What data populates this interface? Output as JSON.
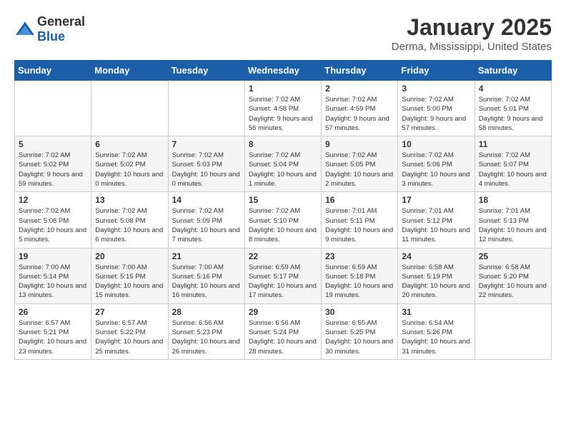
{
  "header": {
    "logo_general": "General",
    "logo_blue": "Blue",
    "title": "January 2025",
    "subtitle": "Derma, Mississippi, United States"
  },
  "weekdays": [
    "Sunday",
    "Monday",
    "Tuesday",
    "Wednesday",
    "Thursday",
    "Friday",
    "Saturday"
  ],
  "weeks": [
    [
      {
        "day": "",
        "info": ""
      },
      {
        "day": "",
        "info": ""
      },
      {
        "day": "",
        "info": ""
      },
      {
        "day": "1",
        "info": "Sunrise: 7:02 AM\nSunset: 4:58 PM\nDaylight: 9 hours and 56 minutes."
      },
      {
        "day": "2",
        "info": "Sunrise: 7:02 AM\nSunset: 4:59 PM\nDaylight: 9 hours and 57 minutes."
      },
      {
        "day": "3",
        "info": "Sunrise: 7:02 AM\nSunset: 5:00 PM\nDaylight: 9 hours and 57 minutes."
      },
      {
        "day": "4",
        "info": "Sunrise: 7:02 AM\nSunset: 5:01 PM\nDaylight: 9 hours and 58 minutes."
      }
    ],
    [
      {
        "day": "5",
        "info": "Sunrise: 7:02 AM\nSunset: 5:02 PM\nDaylight: 9 hours and 59 minutes."
      },
      {
        "day": "6",
        "info": "Sunrise: 7:02 AM\nSunset: 5:02 PM\nDaylight: 10 hours and 0 minutes."
      },
      {
        "day": "7",
        "info": "Sunrise: 7:02 AM\nSunset: 5:03 PM\nDaylight: 10 hours and 0 minutes."
      },
      {
        "day": "8",
        "info": "Sunrise: 7:02 AM\nSunset: 5:04 PM\nDaylight: 10 hours and 1 minute."
      },
      {
        "day": "9",
        "info": "Sunrise: 7:02 AM\nSunset: 5:05 PM\nDaylight: 10 hours and 2 minutes."
      },
      {
        "day": "10",
        "info": "Sunrise: 7:02 AM\nSunset: 5:06 PM\nDaylight: 10 hours and 3 minutes."
      },
      {
        "day": "11",
        "info": "Sunrise: 7:02 AM\nSunset: 5:07 PM\nDaylight: 10 hours and 4 minutes."
      }
    ],
    [
      {
        "day": "12",
        "info": "Sunrise: 7:02 AM\nSunset: 5:08 PM\nDaylight: 10 hours and 5 minutes."
      },
      {
        "day": "13",
        "info": "Sunrise: 7:02 AM\nSunset: 5:08 PM\nDaylight: 10 hours and 6 minutes."
      },
      {
        "day": "14",
        "info": "Sunrise: 7:02 AM\nSunset: 5:09 PM\nDaylight: 10 hours and 7 minutes."
      },
      {
        "day": "15",
        "info": "Sunrise: 7:02 AM\nSunset: 5:10 PM\nDaylight: 10 hours and 8 minutes."
      },
      {
        "day": "16",
        "info": "Sunrise: 7:01 AM\nSunset: 5:11 PM\nDaylight: 10 hours and 9 minutes."
      },
      {
        "day": "17",
        "info": "Sunrise: 7:01 AM\nSunset: 5:12 PM\nDaylight: 10 hours and 11 minutes."
      },
      {
        "day": "18",
        "info": "Sunrise: 7:01 AM\nSunset: 5:13 PM\nDaylight: 10 hours and 12 minutes."
      }
    ],
    [
      {
        "day": "19",
        "info": "Sunrise: 7:00 AM\nSunset: 5:14 PM\nDaylight: 10 hours and 13 minutes."
      },
      {
        "day": "20",
        "info": "Sunrise: 7:00 AM\nSunset: 5:15 PM\nDaylight: 10 hours and 15 minutes."
      },
      {
        "day": "21",
        "info": "Sunrise: 7:00 AM\nSunset: 5:16 PM\nDaylight: 10 hours and 16 minutes."
      },
      {
        "day": "22",
        "info": "Sunrise: 6:59 AM\nSunset: 5:17 PM\nDaylight: 10 hours and 17 minutes."
      },
      {
        "day": "23",
        "info": "Sunrise: 6:59 AM\nSunset: 5:18 PM\nDaylight: 10 hours and 19 minutes."
      },
      {
        "day": "24",
        "info": "Sunrise: 6:58 AM\nSunset: 5:19 PM\nDaylight: 10 hours and 20 minutes."
      },
      {
        "day": "25",
        "info": "Sunrise: 6:58 AM\nSunset: 5:20 PM\nDaylight: 10 hours and 22 minutes."
      }
    ],
    [
      {
        "day": "26",
        "info": "Sunrise: 6:57 AM\nSunset: 5:21 PM\nDaylight: 10 hours and 23 minutes."
      },
      {
        "day": "27",
        "info": "Sunrise: 6:57 AM\nSunset: 5:22 PM\nDaylight: 10 hours and 25 minutes."
      },
      {
        "day": "28",
        "info": "Sunrise: 6:56 AM\nSunset: 5:23 PM\nDaylight: 10 hours and 26 minutes."
      },
      {
        "day": "29",
        "info": "Sunrise: 6:56 AM\nSunset: 5:24 PM\nDaylight: 10 hours and 28 minutes."
      },
      {
        "day": "30",
        "info": "Sunrise: 6:55 AM\nSunset: 5:25 PM\nDaylight: 10 hours and 30 minutes."
      },
      {
        "day": "31",
        "info": "Sunrise: 6:54 AM\nSunset: 5:26 PM\nDaylight: 10 hours and 31 minutes."
      },
      {
        "day": "",
        "info": ""
      }
    ]
  ]
}
